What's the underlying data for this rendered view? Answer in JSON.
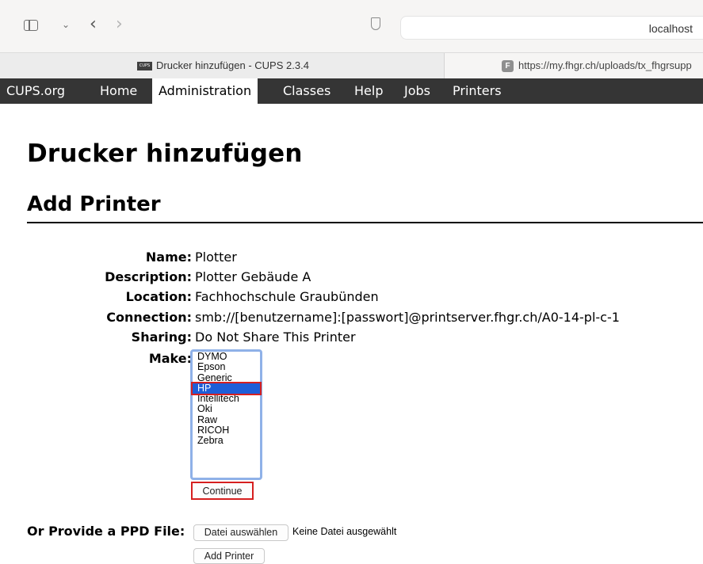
{
  "browser": {
    "address": "localhost",
    "tabs": [
      {
        "favicon": "CUPS",
        "title": "Drucker hinzufügen - CUPS 2.3.4"
      },
      {
        "favicon": "F",
        "title": "https://my.fhgr.ch/uploads/tx_fhgrsupp"
      }
    ]
  },
  "nav": {
    "items": [
      "CUPS.org",
      "Home",
      "Administration",
      "Classes",
      "Help",
      "Jobs",
      "Printers"
    ],
    "active": "Administration"
  },
  "page": {
    "title": "Drucker hinzufügen",
    "section": "Add Printer"
  },
  "form": {
    "fields": [
      {
        "label": "Name:",
        "value": "Plotter"
      },
      {
        "label": "Description:",
        "value": "Plotter Gebäude A"
      },
      {
        "label": "Location:",
        "value": "Fachhochschule Graubünden"
      },
      {
        "label": "Connection:",
        "value": "smb://[benutzername]:[passwort]@printserver.fhgr.ch/A0-14-pl-c-1"
      },
      {
        "label": "Sharing:",
        "value": "Do Not Share This Printer"
      }
    ],
    "make_label": "Make:",
    "make_options": [
      "DYMO",
      "Epson",
      "Generic",
      "HP",
      "Intellitech",
      "Oki",
      "Raw",
      "RICOH",
      "Zebra"
    ],
    "make_selected": "HP",
    "continue_label": "Continue",
    "ppd_label": "Or Provide a PPD File:",
    "choose_file_label": "Datei auswählen",
    "no_file_text": "Keine Datei ausgewählt",
    "add_printer_label": "Add Printer"
  },
  "colors": {
    "nav_bg": "#353535",
    "select_border": "#8fb1e8",
    "selected_option": "#1e5ed8",
    "highlight": "#d62020"
  }
}
